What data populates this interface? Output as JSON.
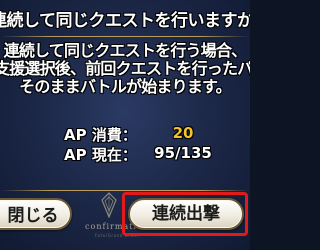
{
  "dialog": {
    "title": "連続して同じクエストを行いますか？",
    "message_lines": [
      "連続して同じクエストを行う場合、",
      "支援選択後、前回クエストを行ったパーティ編成",
      "そのままバトルが始まります。"
    ],
    "ap": {
      "cost_label": "AP 消費：",
      "cost_value": "20",
      "current_label": "AP 現在：",
      "current_value": "95/135"
    },
    "buttons": {
      "close_label": "閉じる",
      "continue_label": "連続出撃"
    },
    "footer": {
      "confirm_text": "confirmation",
      "sub_text": "Fate/Grand Order"
    }
  },
  "colors": {
    "background": "#1b2645",
    "frame": "#c9a85c",
    "cost_value": "#f2c230",
    "highlight": "#e41a1a",
    "button": "#f1ede2"
  }
}
